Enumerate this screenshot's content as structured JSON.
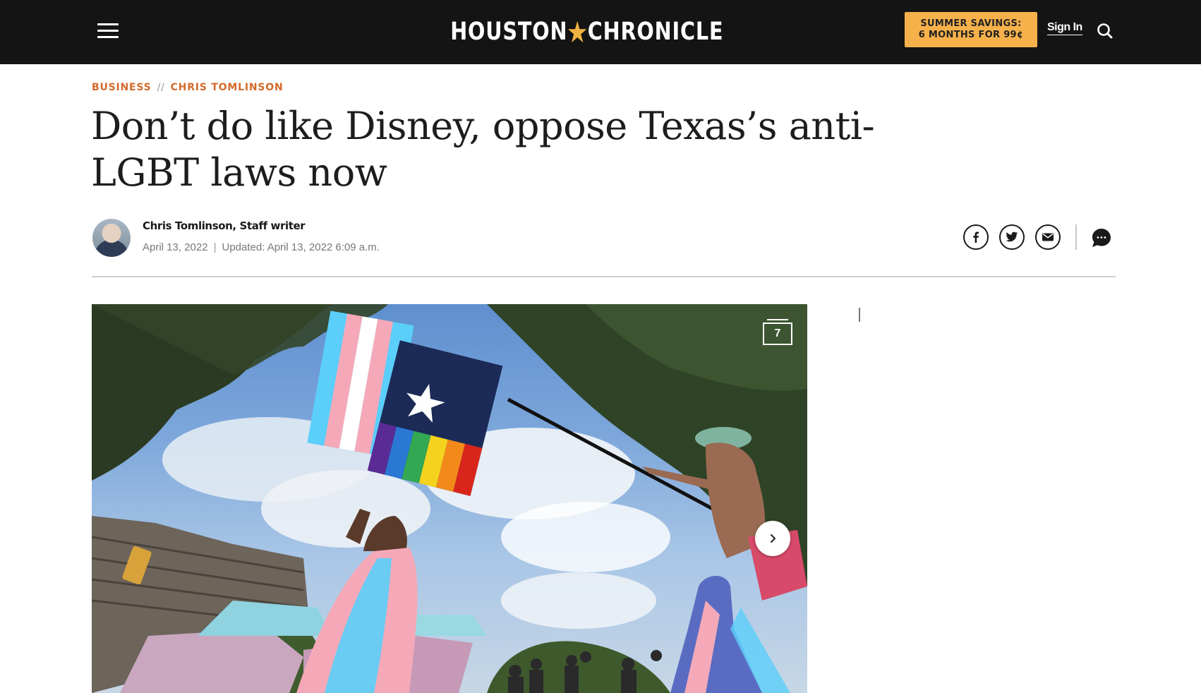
{
  "header": {
    "logo_left": "HOUSTON",
    "logo_right": "CHRONICLE",
    "promo_line1": "SUMMER SAVINGS:",
    "promo_line2": "6 MONTHS FOR 99¢",
    "signin_label": "Sign In",
    "icons": [
      "menu-icon",
      "search-icon"
    ],
    "bg_color": "#141414",
    "promo_color": "#f6b14b"
  },
  "article": {
    "section": "BUSINESS",
    "kicker_sep": "//",
    "column": "CHRIS TOMLINSON",
    "headline": "Don’t do like Disney, oppose Texas’s anti-LGBT laws now",
    "author": "Chris Tomlinson, Staff writer",
    "published": "April 13, 2022",
    "date_sep": "|",
    "updated": "Updated: April 13, 2022 6:09 a.m.",
    "share_icons": [
      "facebook-icon",
      "twitter-icon",
      "email-icon",
      "comment-icon"
    ],
    "kicker_color": "#d46a2a"
  },
  "photo": {
    "gallery_count": "7",
    "next_icon": "chevron-right-icon"
  }
}
